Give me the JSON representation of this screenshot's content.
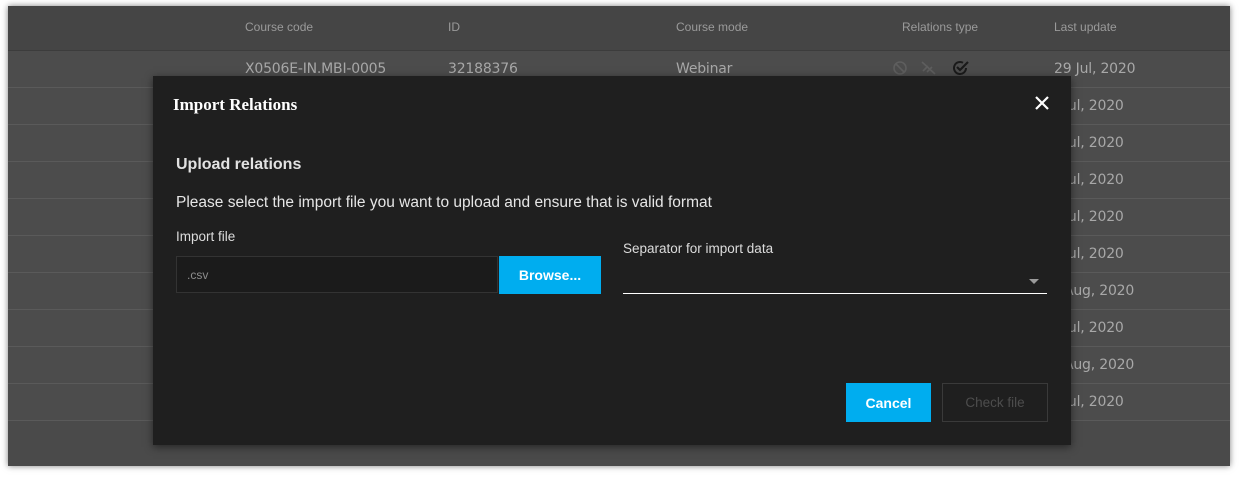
{
  "table": {
    "headers": {
      "course_code": "Course code",
      "id": "ID",
      "course_mode": "Course mode",
      "relations_type": "Relations type",
      "last_update": "Last update"
    },
    "rows": [
      {
        "course_code": "X0506E-IN.MBI-0005",
        "id": "32188376",
        "course_mode": "Webinar",
        "last_update": "29 Jul, 2020"
      },
      {
        "last_update": "Jul, 2020"
      },
      {
        "last_update": "Jul, 2020"
      },
      {
        "last_update": "Jul, 2020"
      },
      {
        "last_update": "Jul, 2020"
      },
      {
        "last_update": "Jul, 2020"
      },
      {
        "last_update": "Aug, 2020"
      },
      {
        "last_update": "Jul, 2020"
      },
      {
        "last_update": "Aug, 2020"
      },
      {
        "last_update": "Jul, 2020"
      }
    ],
    "relation_icons": [
      "prohibited-icon",
      "no-link-icon",
      "check-circle-icon"
    ]
  },
  "modal": {
    "title": "Import Relations",
    "section_title": "Upload relations",
    "description": "Please select the import file you want to upload and ensure that is valid format",
    "import_label": "Import file",
    "file_placeholder": ".csv",
    "browse_label": "Browse...",
    "separator_label": "Separator for import data",
    "separator_value": "",
    "cancel_label": "Cancel",
    "check_label": "Check file"
  },
  "colors": {
    "accent": "#00adef",
    "modal_bg": "#1f1f1f",
    "backdrop": "#4a4a4a"
  }
}
